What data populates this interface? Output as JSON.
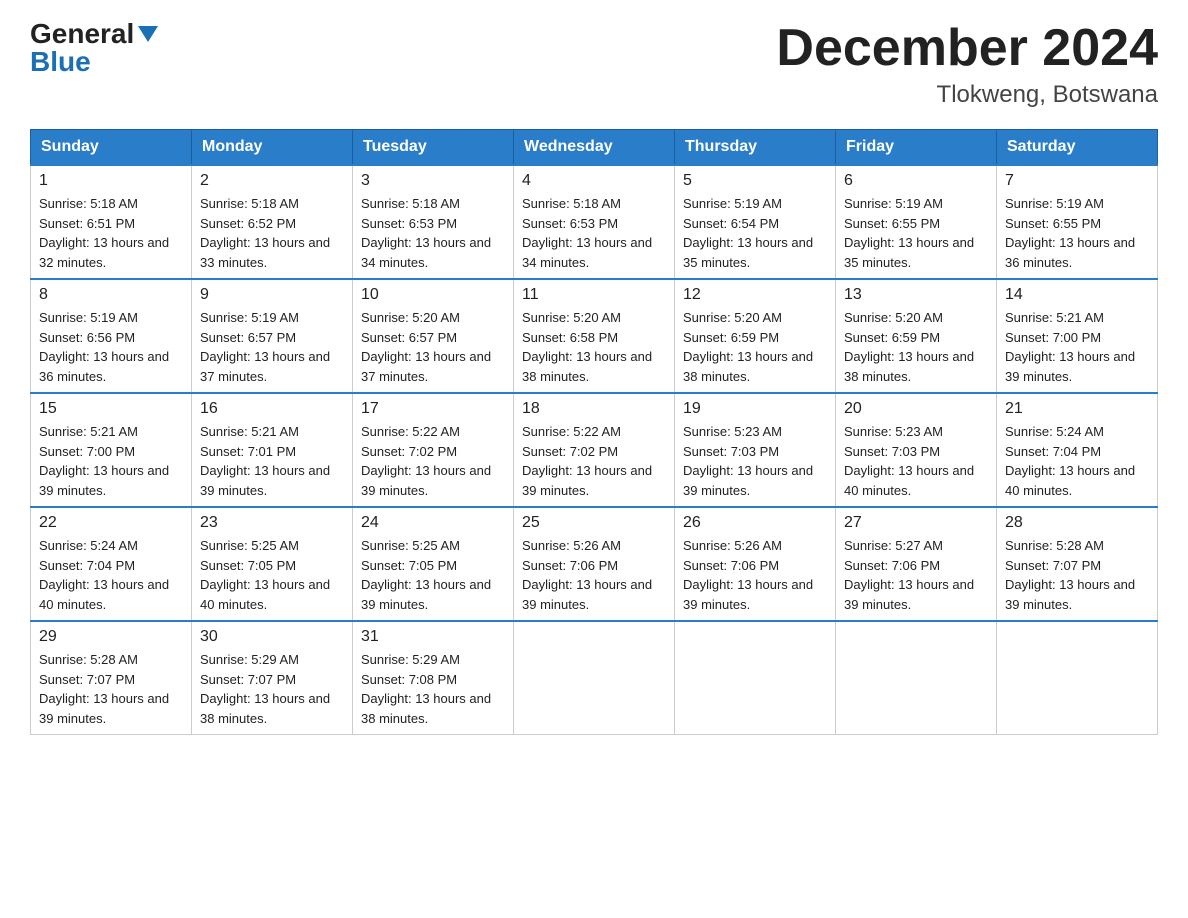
{
  "header": {
    "logo_general": "General",
    "logo_blue": "Blue",
    "month_title": "December 2024",
    "location": "Tlokweng, Botswana"
  },
  "days_of_week": [
    "Sunday",
    "Monday",
    "Tuesday",
    "Wednesday",
    "Thursday",
    "Friday",
    "Saturday"
  ],
  "weeks": [
    [
      {
        "day": "1",
        "sunrise": "5:18 AM",
        "sunset": "6:51 PM",
        "daylight": "13 hours and 32 minutes."
      },
      {
        "day": "2",
        "sunrise": "5:18 AM",
        "sunset": "6:52 PM",
        "daylight": "13 hours and 33 minutes."
      },
      {
        "day": "3",
        "sunrise": "5:18 AM",
        "sunset": "6:53 PM",
        "daylight": "13 hours and 34 minutes."
      },
      {
        "day": "4",
        "sunrise": "5:18 AM",
        "sunset": "6:53 PM",
        "daylight": "13 hours and 34 minutes."
      },
      {
        "day": "5",
        "sunrise": "5:19 AM",
        "sunset": "6:54 PM",
        "daylight": "13 hours and 35 minutes."
      },
      {
        "day": "6",
        "sunrise": "5:19 AM",
        "sunset": "6:55 PM",
        "daylight": "13 hours and 35 minutes."
      },
      {
        "day": "7",
        "sunrise": "5:19 AM",
        "sunset": "6:55 PM",
        "daylight": "13 hours and 36 minutes."
      }
    ],
    [
      {
        "day": "8",
        "sunrise": "5:19 AM",
        "sunset": "6:56 PM",
        "daylight": "13 hours and 36 minutes."
      },
      {
        "day": "9",
        "sunrise": "5:19 AM",
        "sunset": "6:57 PM",
        "daylight": "13 hours and 37 minutes."
      },
      {
        "day": "10",
        "sunrise": "5:20 AM",
        "sunset": "6:57 PM",
        "daylight": "13 hours and 37 minutes."
      },
      {
        "day": "11",
        "sunrise": "5:20 AM",
        "sunset": "6:58 PM",
        "daylight": "13 hours and 38 minutes."
      },
      {
        "day": "12",
        "sunrise": "5:20 AM",
        "sunset": "6:59 PM",
        "daylight": "13 hours and 38 minutes."
      },
      {
        "day": "13",
        "sunrise": "5:20 AM",
        "sunset": "6:59 PM",
        "daylight": "13 hours and 38 minutes."
      },
      {
        "day": "14",
        "sunrise": "5:21 AM",
        "sunset": "7:00 PM",
        "daylight": "13 hours and 39 minutes."
      }
    ],
    [
      {
        "day": "15",
        "sunrise": "5:21 AM",
        "sunset": "7:00 PM",
        "daylight": "13 hours and 39 minutes."
      },
      {
        "day": "16",
        "sunrise": "5:21 AM",
        "sunset": "7:01 PM",
        "daylight": "13 hours and 39 minutes."
      },
      {
        "day": "17",
        "sunrise": "5:22 AM",
        "sunset": "7:02 PM",
        "daylight": "13 hours and 39 minutes."
      },
      {
        "day": "18",
        "sunrise": "5:22 AM",
        "sunset": "7:02 PM",
        "daylight": "13 hours and 39 minutes."
      },
      {
        "day": "19",
        "sunrise": "5:23 AM",
        "sunset": "7:03 PM",
        "daylight": "13 hours and 39 minutes."
      },
      {
        "day": "20",
        "sunrise": "5:23 AM",
        "sunset": "7:03 PM",
        "daylight": "13 hours and 40 minutes."
      },
      {
        "day": "21",
        "sunrise": "5:24 AM",
        "sunset": "7:04 PM",
        "daylight": "13 hours and 40 minutes."
      }
    ],
    [
      {
        "day": "22",
        "sunrise": "5:24 AM",
        "sunset": "7:04 PM",
        "daylight": "13 hours and 40 minutes."
      },
      {
        "day": "23",
        "sunrise": "5:25 AM",
        "sunset": "7:05 PM",
        "daylight": "13 hours and 40 minutes."
      },
      {
        "day": "24",
        "sunrise": "5:25 AM",
        "sunset": "7:05 PM",
        "daylight": "13 hours and 39 minutes."
      },
      {
        "day": "25",
        "sunrise": "5:26 AM",
        "sunset": "7:06 PM",
        "daylight": "13 hours and 39 minutes."
      },
      {
        "day": "26",
        "sunrise": "5:26 AM",
        "sunset": "7:06 PM",
        "daylight": "13 hours and 39 minutes."
      },
      {
        "day": "27",
        "sunrise": "5:27 AM",
        "sunset": "7:06 PM",
        "daylight": "13 hours and 39 minutes."
      },
      {
        "day": "28",
        "sunrise": "5:28 AM",
        "sunset": "7:07 PM",
        "daylight": "13 hours and 39 minutes."
      }
    ],
    [
      {
        "day": "29",
        "sunrise": "5:28 AM",
        "sunset": "7:07 PM",
        "daylight": "13 hours and 39 minutes."
      },
      {
        "day": "30",
        "sunrise": "5:29 AM",
        "sunset": "7:07 PM",
        "daylight": "13 hours and 38 minutes."
      },
      {
        "day": "31",
        "sunrise": "5:29 AM",
        "sunset": "7:08 PM",
        "daylight": "13 hours and 38 minutes."
      },
      null,
      null,
      null,
      null
    ]
  ],
  "labels": {
    "sunrise": "Sunrise: ",
    "sunset": "Sunset: ",
    "daylight": "Daylight: "
  }
}
